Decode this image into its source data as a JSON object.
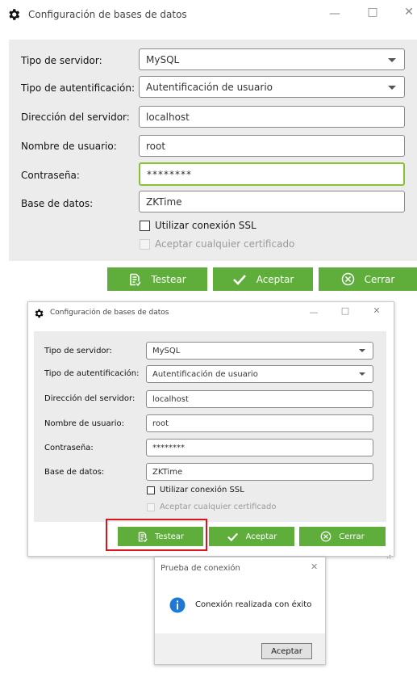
{
  "window_top": {
    "title": "Configuración de bases de datos",
    "labels": {
      "server_type": "Tipo de servidor:",
      "auth_type": "Tipo de autentificación:",
      "server_address": "Dirección del servidor:",
      "username": "Nombre de usuario:",
      "password": "Contraseña:",
      "database": "Base de datos:"
    },
    "values": {
      "server_type": "MySQL",
      "auth_type": "Autentificación de usuario",
      "server_address": "localhost",
      "username": "root",
      "password": "********",
      "database": "ZKTime"
    },
    "checkbox_ssl": "Utilizar conexión SSL",
    "checkbox_cert": "Aceptar cualquier certificado",
    "buttons": {
      "test": "Testear",
      "accept": "Aceptar",
      "close": "Cerrar"
    }
  },
  "window_bottom": {
    "title": "Configuración de bases de datos",
    "labels": {
      "server_type": "Tipo de servidor:",
      "auth_type": "Tipo de autentificación:",
      "server_address": "Dirección del servidor:",
      "username": "Nombre de usuario:",
      "password": "Contraseña:",
      "database": "Base de datos:"
    },
    "values": {
      "server_type": "MySQL",
      "auth_type": "Autentificación de usuario",
      "server_address": "localhost",
      "username": "root",
      "password": "********",
      "database": "ZKTime"
    },
    "checkbox_ssl": "Utilizar conexión SSL",
    "checkbox_cert": "Aceptar cualquier certificado",
    "buttons": {
      "test": "Testear",
      "accept": "Aceptar",
      "close": "Cerrar"
    }
  },
  "dialog": {
    "title": "Prueba de conexión",
    "message": "Conexión realizada con éxito",
    "accept": "Aceptar"
  },
  "colors": {
    "accent_green": "#5fae3b",
    "focus_green": "#86c232",
    "highlight_red": "#d9151b",
    "info_blue": "#1e78d7"
  },
  "icons": [
    "gear-icon",
    "minimize-icon",
    "maximize-icon",
    "close-icon",
    "test-icon",
    "check-icon",
    "cancel-circle-icon",
    "info-icon",
    "resize-grip-icon"
  ]
}
